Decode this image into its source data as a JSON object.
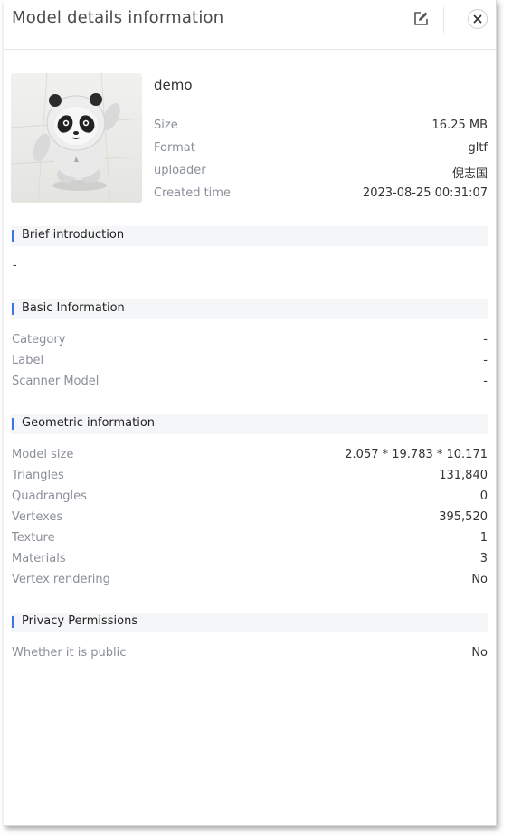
{
  "header": {
    "title": "Model details information"
  },
  "model": {
    "name": "demo",
    "size_label": "Size",
    "size": "16.25 MB",
    "format_label": "Format",
    "format": "gltf",
    "uploader_label": "uploader",
    "uploader": "倪志国",
    "created_label": "Created time",
    "created": "2023-08-25 00:31:07"
  },
  "brief": {
    "title": "Brief introduction",
    "text": "-"
  },
  "basic": {
    "title": "Basic Information",
    "rows": [
      {
        "label": "Category",
        "value": "-"
      },
      {
        "label": "Label",
        "value": "-"
      },
      {
        "label": "Scanner Model",
        "value": "-"
      }
    ]
  },
  "geometric": {
    "title": "Geometric information",
    "rows": [
      {
        "label": "Model size",
        "value": "2.057 * 19.783 * 10.171"
      },
      {
        "label": "Triangles",
        "value": "131,840"
      },
      {
        "label": "Quadrangles",
        "value": "0"
      },
      {
        "label": "Vertexes",
        "value": "395,520"
      },
      {
        "label": "Texture",
        "value": "1"
      },
      {
        "label": "Materials",
        "value": "3"
      },
      {
        "label": "Vertex rendering",
        "value": "No"
      }
    ]
  },
  "privacy": {
    "title": "Privacy Permissions",
    "rows": [
      {
        "label": "Whether it is public",
        "value": "No"
      }
    ]
  },
  "colors": {
    "accent": "#3f74e8",
    "label": "#8a8f99",
    "value": "#333333"
  },
  "icons": {
    "edit": "edit-icon",
    "close": "close-icon"
  }
}
